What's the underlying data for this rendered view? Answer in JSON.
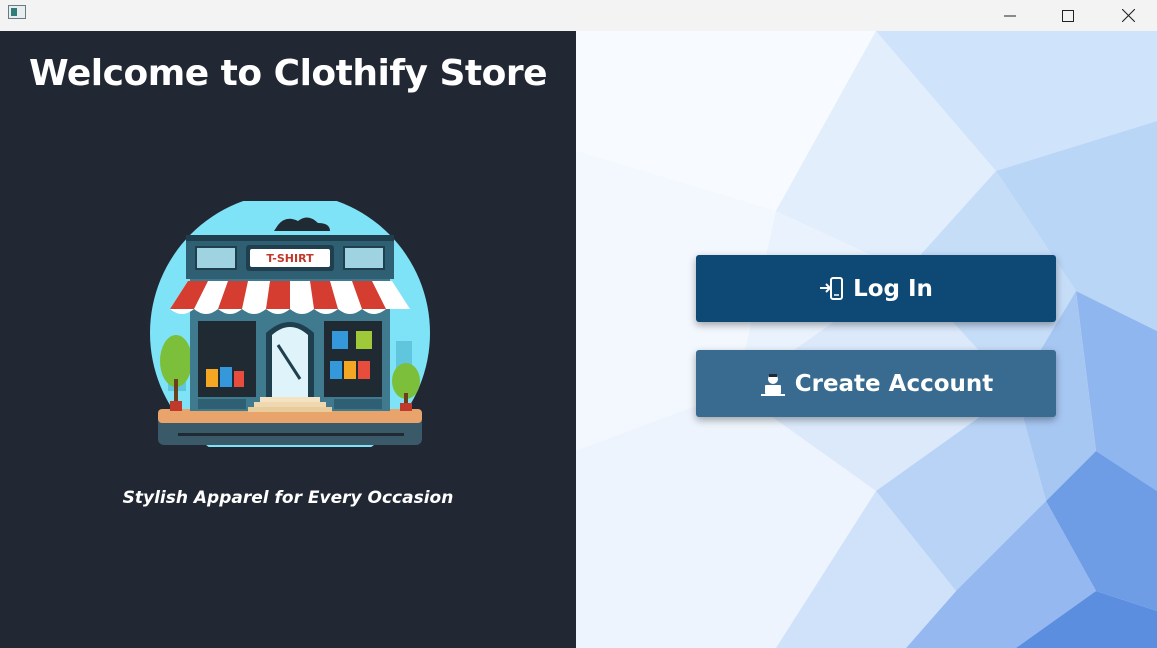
{
  "window": {
    "icons": {
      "app": "app-icon",
      "minimize": "minimize-icon",
      "maximize": "maximize-icon",
      "close": "close-icon"
    }
  },
  "left_panel": {
    "title": "Welcome to Clothify Store",
    "sign_text": "T-SHIRT",
    "tagline": "Stylish Apparel for Every Occasion",
    "background": "#222833"
  },
  "actions": {
    "login_label": "Log In",
    "login_icon": "login-phone-icon",
    "create_label": "Create Account",
    "create_icon": "user-laptop-icon",
    "login_color": "#0e4874",
    "create_color": "#386b8f"
  }
}
